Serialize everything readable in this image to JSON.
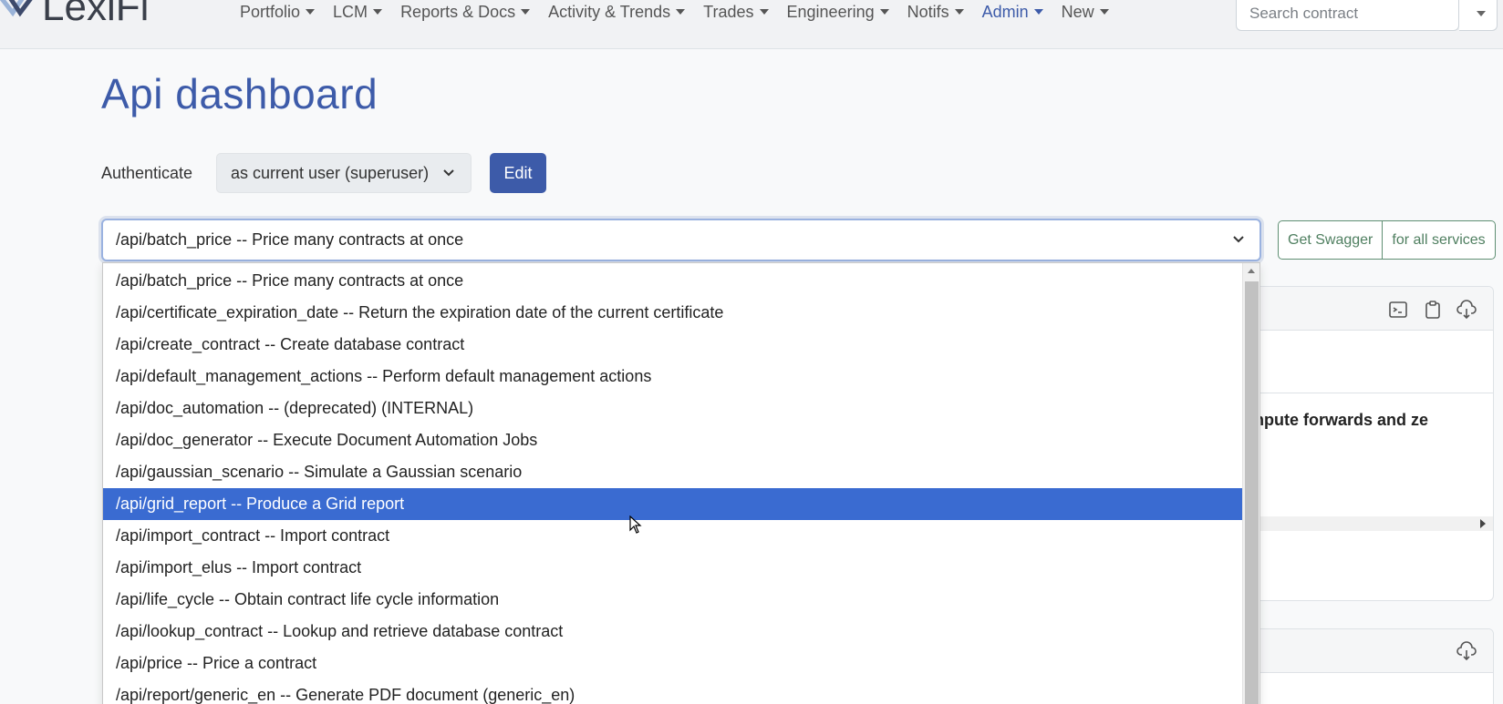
{
  "brand": {
    "logo_text": "LexiFi"
  },
  "nav": {
    "items": [
      {
        "label": "Portfolio",
        "name": "nav-portfolio"
      },
      {
        "label": "LCM",
        "name": "nav-lcm"
      },
      {
        "label": "Reports & Docs",
        "name": "nav-reports-docs"
      },
      {
        "label": "Activity & Trends",
        "name": "nav-activity-trends"
      },
      {
        "label": "Trades",
        "name": "nav-trades"
      },
      {
        "label": "Engineering",
        "name": "nav-engineering"
      },
      {
        "label": "Notifs",
        "name": "nav-notifs"
      },
      {
        "label": "Admin",
        "name": "nav-admin",
        "active": true
      },
      {
        "label": "New",
        "name": "nav-new"
      }
    ],
    "search_placeholder": "Search contract"
  },
  "page": {
    "title": "Api dashboard",
    "auth_label": "Authenticate",
    "auth_value": "as current user (superuser)",
    "edit_label": "Edit",
    "endpoint_value": "/api/batch_price -- Price many contracts at once",
    "swagger_label": "Get Swagger",
    "swagger_all_label": "for all services",
    "panel_text": "s  Compute forwards and ze"
  },
  "dropdown": {
    "selected_index": 7,
    "options": [
      "/api/batch_price -- Price many contracts at once",
      "/api/certificate_expiration_date -- Return the expiration date of the current certificate",
      "/api/create_contract -- Create database contract",
      "/api/default_management_actions -- Perform default management actions",
      "/api/doc_automation -- (deprecated) (INTERNAL)",
      "/api/doc_generator -- Execute Document Automation Jobs",
      "/api/gaussian_scenario -- Simulate a Gaussian scenario",
      "/api/grid_report -- Produce a Grid report",
      "/api/import_contract -- Import contract",
      "/api/import_elus -- Import contract",
      "/api/life_cycle -- Obtain contract life cycle information",
      "/api/lookup_contract -- Lookup and retrieve database contract",
      "/api/price -- Price a contract",
      "/api/report/generic_en -- Generate PDF document (generic_en)"
    ]
  },
  "colors": {
    "accent": "#3d5ba9",
    "selected_option": "#3a6bd1",
    "swagger_green": "#4f7f60"
  }
}
